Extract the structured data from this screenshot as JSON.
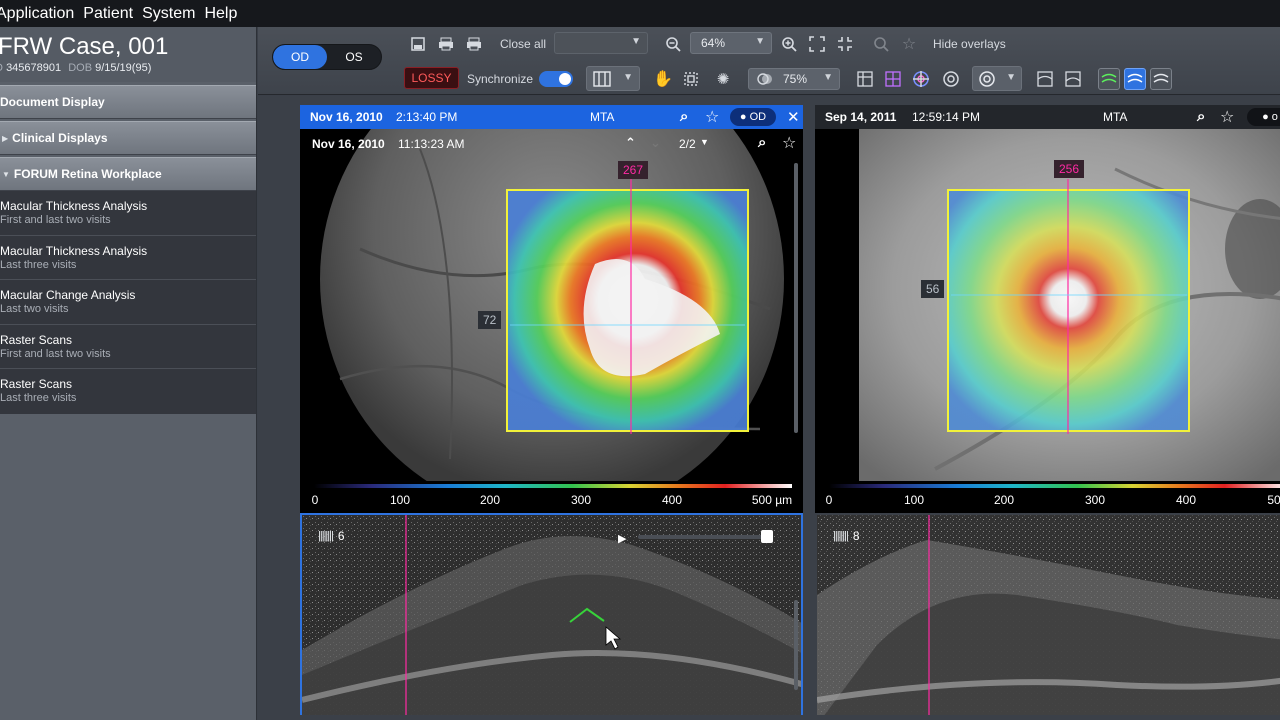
{
  "menu": [
    "Application",
    "Patient",
    "System",
    "Help"
  ],
  "patient": {
    "name": "FRW Case, 001",
    "id_label": "ID",
    "id_value": "345678901",
    "dob_label": "DOB",
    "dob_value": "9/15/19(95)"
  },
  "sidebar": {
    "sections": [
      {
        "label": "Document Display"
      },
      {
        "label": "Clinical Displays"
      },
      {
        "label": "FORUM Retina Workplace"
      }
    ],
    "items": [
      {
        "title": "Macular Thickness Analysis",
        "subtitle": "First and last two visits"
      },
      {
        "title": "Macular Thickness Analysis",
        "subtitle": "Last three visits"
      },
      {
        "title": "Macular Change Analysis",
        "subtitle": "Last two visits"
      },
      {
        "title": "Raster Scans",
        "subtitle": "First and last two visits"
      },
      {
        "title": "Raster Scans",
        "subtitle": "Last three visits"
      }
    ]
  },
  "toolbar": {
    "eye_od": "OD",
    "eye_os": "OS",
    "close_all": "Close all",
    "zoom_value": "64%",
    "hide_overlays": "Hide overlays",
    "lossy": "LOSSY",
    "synchronize": "Synchronize",
    "opacity_value": "75%"
  },
  "left_panel": {
    "header_date": "Nov 16, 2010",
    "header_time": "2:13:40 PM",
    "header_op": "MTA",
    "eye": "OD",
    "sub_date": "Nov 16, 2010",
    "sub_time": "11:13:23 AM",
    "page": "2/2",
    "top_value": "267",
    "left_value": "72",
    "scan_index": "6",
    "scale_ticks": [
      "0",
      "100",
      "200",
      "300",
      "400",
      "500 µm"
    ]
  },
  "right_panel": {
    "header_date": "Sep 14, 2011",
    "header_time": "12:59:14 PM",
    "header_op": "MTA",
    "top_value": "256",
    "left_value": "56",
    "scan_index": "8",
    "scale_ticks": [
      "0",
      "100",
      "200",
      "300",
      "400",
      "50"
    ]
  },
  "colors": {
    "accent": "#2f73e0",
    "lossy": "#ff5a5a",
    "crosshair": "#ff2aa4",
    "roi": "#f2f23a"
  }
}
